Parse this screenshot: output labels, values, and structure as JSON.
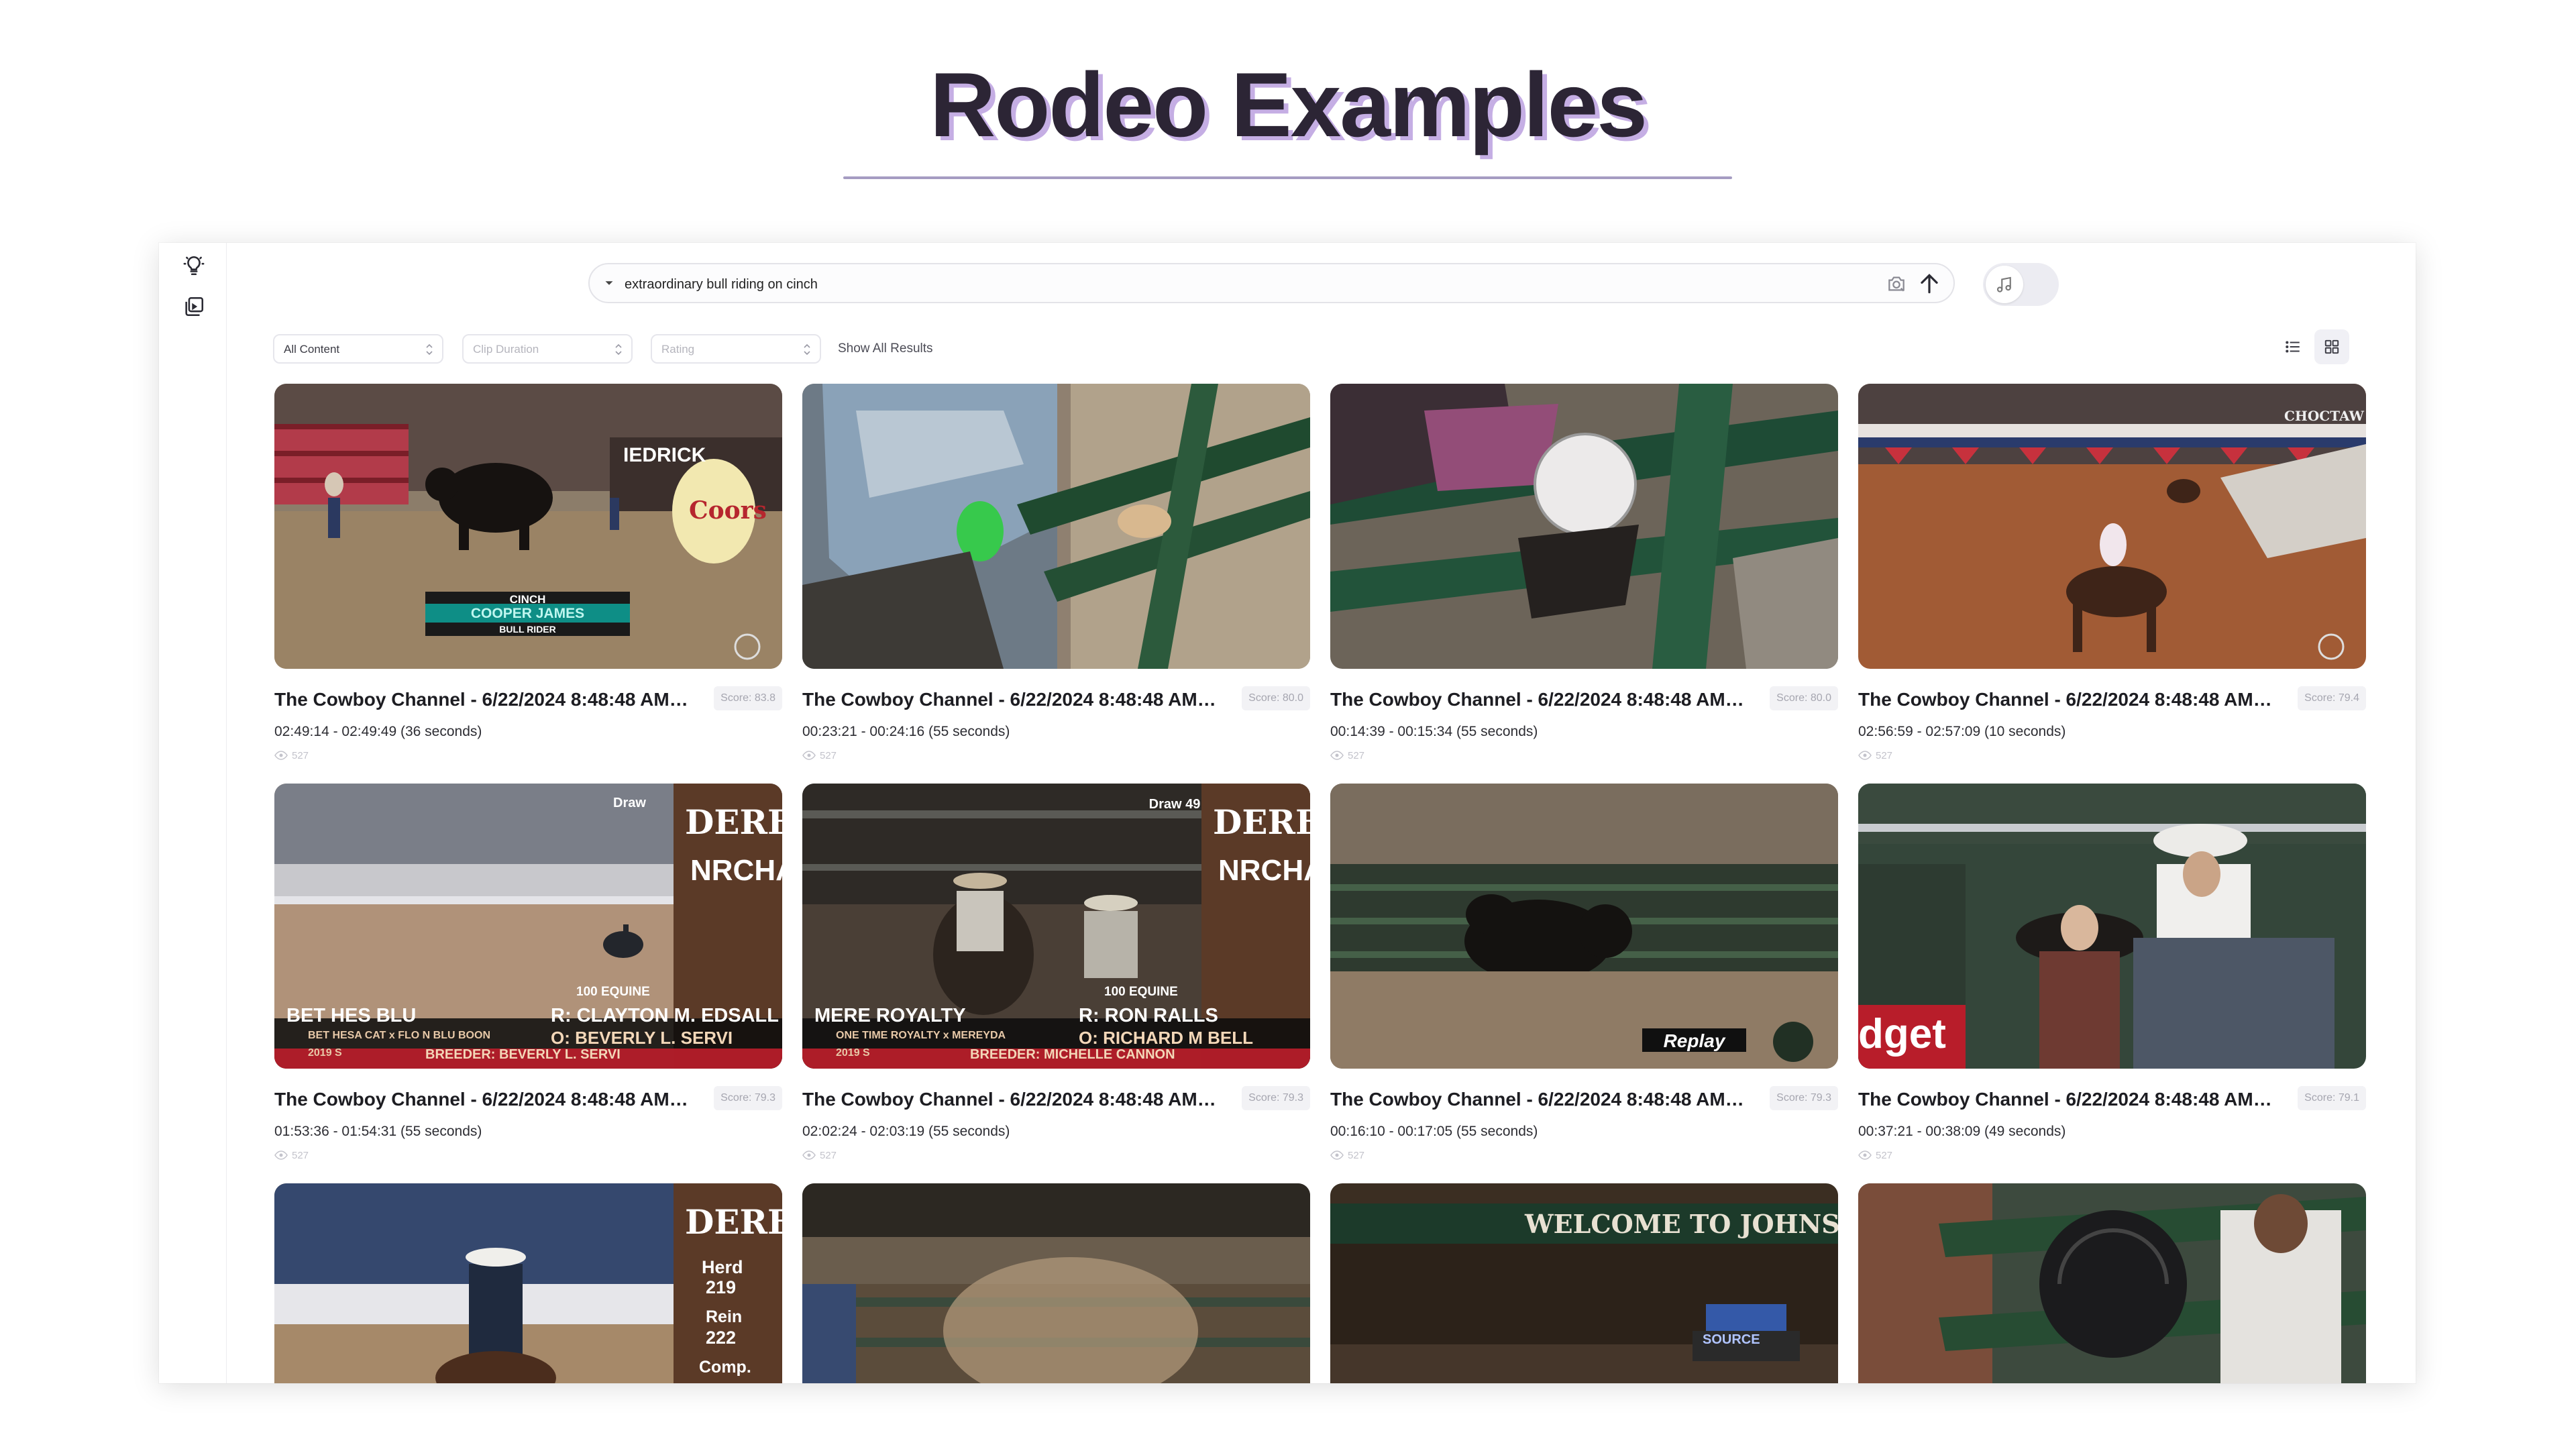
{
  "slide": {
    "title": "Rodeo Examples"
  },
  "search": {
    "query": "extraordinary bull riding on cinch"
  },
  "filters": {
    "content": "All Content",
    "duration": "Clip Duration",
    "rating": "Rating",
    "show_all": "Show All Results"
  },
  "results": [
    {
      "title": "The Cowboy Channel - 6/22/2024 8:48:48 AM t...",
      "score": "Score: 83.8",
      "time": "02:49:14 - 02:49:49 (36 seconds)",
      "views": "527",
      "overlay": {
        "line1": "CINCH",
        "line2": "COOPER JAMES",
        "line3": "BULL RIDER",
        "sign": "IEDRICK",
        "cup": "Coors"
      }
    },
    {
      "title": "The Cowboy Channel - 6/22/2024 8:48:48 AM t...",
      "score": "Score: 80.0",
      "time": "00:23:21 - 00:24:16 (55 seconds)",
      "views": "527"
    },
    {
      "title": "The Cowboy Channel - 6/22/2024 8:48:48 AM t...",
      "score": "Score: 80.0",
      "time": "00:14:39 - 00:15:34 (55 seconds)",
      "views": "527"
    },
    {
      "title": "The Cowboy Channel - 6/22/2024 8:48:48 AM t...",
      "score": "Score: 79.4",
      "time": "02:56:59 - 02:57:09 (10 seconds)",
      "views": "527",
      "overlay": {
        "sign": "CHOCTAW"
      }
    },
    {
      "title": "The Cowboy Channel - 6/22/2024 8:48:48 AM t...",
      "score": "Score: 79.3",
      "time": "01:53:36 - 01:54:31 (55 seconds)",
      "views": "527",
      "overlay": {
        "name": "BET HES BLU",
        "rider": "R: CLAYTON M. EDSALL",
        "owner": "O: BEVERLY L. SERVI",
        "breeding": "BET HESA CAT x FLO N BLU BOON",
        "year": "2019 S",
        "breeder": "BREEDER: BEVERLY L. SERVI",
        "draw": "Draw",
        "brand": "DERBY",
        "org": "NRCHA",
        "sponsor": "100 EQUINE"
      }
    },
    {
      "title": "The Cowboy Channel - 6/22/2024 8:48:48 AM t...",
      "score": "Score: 79.3",
      "time": "02:02:24 - 02:03:19 (55 seconds)",
      "views": "527",
      "overlay": {
        "name": "MERE ROYALTY",
        "rider": "R: RON RALLS",
        "owner": "O: RICHARD M BELL",
        "breeding": "ONE TIME ROYALTY x MEREYDA",
        "year": "2019 S",
        "breeder": "BREEDER: MICHELLE CANNON",
        "draw": "Draw 49",
        "brand": "DERBY",
        "org": "NRCHA",
        "sponsor": "100 EQUINE"
      }
    },
    {
      "title": "The Cowboy Channel - 6/22/2024 8:48:48 AM t...",
      "score": "Score: 79.3",
      "time": "00:16:10 - 00:17:05 (55 seconds)",
      "views": "527",
      "overlay": {
        "replay": "Replay"
      }
    },
    {
      "title": "The Cowboy Channel - 6/22/2024 8:48:48 AM t...",
      "score": "Score: 79.1",
      "time": "00:37:21 - 00:38:09 (49 seconds)",
      "views": "527",
      "overlay": {
        "sign": "dget"
      }
    },
    {
      "overlay": {
        "brand": "DERBY",
        "herd": "Herd",
        "herd_val": "219",
        "rein": "Rein",
        "rein_val": "222",
        "comp": "Comp."
      }
    },
    {},
    {
      "overlay": {
        "sign": "WELCOME TO JOHNSON",
        "source": "SOURCE"
      }
    },
    {}
  ],
  "icons": {
    "rail": [
      "lightbulb-icon",
      "library-icon"
    ],
    "search": [
      "chevron-down-icon",
      "image-search-icon",
      "arrow-up-icon"
    ],
    "music": "music-note-icon",
    "view": [
      "list-view-icon",
      "grid-view-icon"
    ]
  }
}
